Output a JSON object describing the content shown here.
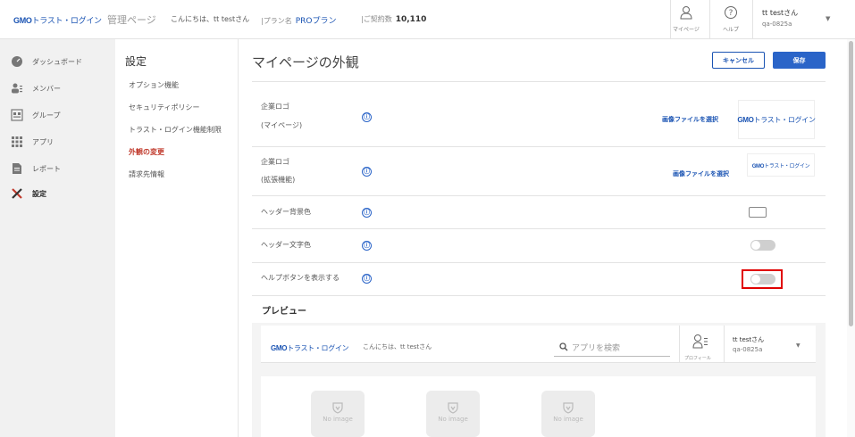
{
  "header": {
    "logo_gmo": "GMO",
    "logo_rest": "トラスト・ログイン",
    "admin_label": "管理ページ",
    "greeting": "こんにちは、tt testさん",
    "plan_label": "|プラン名",
    "plan_value": "PROプラン",
    "contract_label": "|ご契約数",
    "contract_value": "10,110",
    "mypage_label": "マイページ",
    "help_label": "ヘルプ",
    "user_name": "tt testさん",
    "user_code": "qa-0825a"
  },
  "sidebar": {
    "items": [
      {
        "label": "ダッシュボード",
        "icon": "dashboard-icon"
      },
      {
        "label": "メンバー",
        "icon": "members-icon"
      },
      {
        "label": "グループ",
        "icon": "group-icon"
      },
      {
        "label": "アプリ",
        "icon": "apps-icon"
      },
      {
        "label": "レポート",
        "icon": "report-icon"
      },
      {
        "label": "設定",
        "icon": "settings-tools-icon"
      }
    ]
  },
  "subnav": {
    "title": "設定",
    "items": [
      {
        "label": "オプション機能"
      },
      {
        "label": "セキュリティポリシー"
      },
      {
        "label": "トラスト・ログイン機能制限"
      },
      {
        "label": "外観の変更"
      },
      {
        "label": "請求先情報"
      }
    ]
  },
  "main": {
    "title": "マイページの外観",
    "cancel_label": "キャンセル",
    "save_label": "保存",
    "settings": {
      "company_logo_mypage": {
        "label": "企業ロゴ",
        "sublabel": "(マイページ)",
        "file_button": "画像ファイルを選択"
      },
      "company_logo_extension": {
        "label": "企業ロゴ",
        "sublabel": "(拡張機能)",
        "file_button": "画像ファイルを選択"
      },
      "header_bg_color": {
        "label": "ヘッダー背景色",
        "value": "#ffffff"
      },
      "header_text_color": {
        "label": "ヘッダー文字色",
        "enabled": false
      },
      "show_help_button": {
        "label": "ヘルプボタンを表示する",
        "enabled": false
      }
    },
    "info_glyph": "ⓘ"
  },
  "preview": {
    "title": "プレビュー",
    "greeting": "こんにちは、tt testさん",
    "search_placeholder": "アプリを検索",
    "profile_label": "プロフィール",
    "user_name": "tt testさん",
    "user_code": "qa-0825a",
    "no_image_label": "No image"
  },
  "colors": {
    "accent": "#2a64c8",
    "brand": "#1b54b3",
    "active_nav": "#c0392b",
    "highlight": "#e00000"
  }
}
